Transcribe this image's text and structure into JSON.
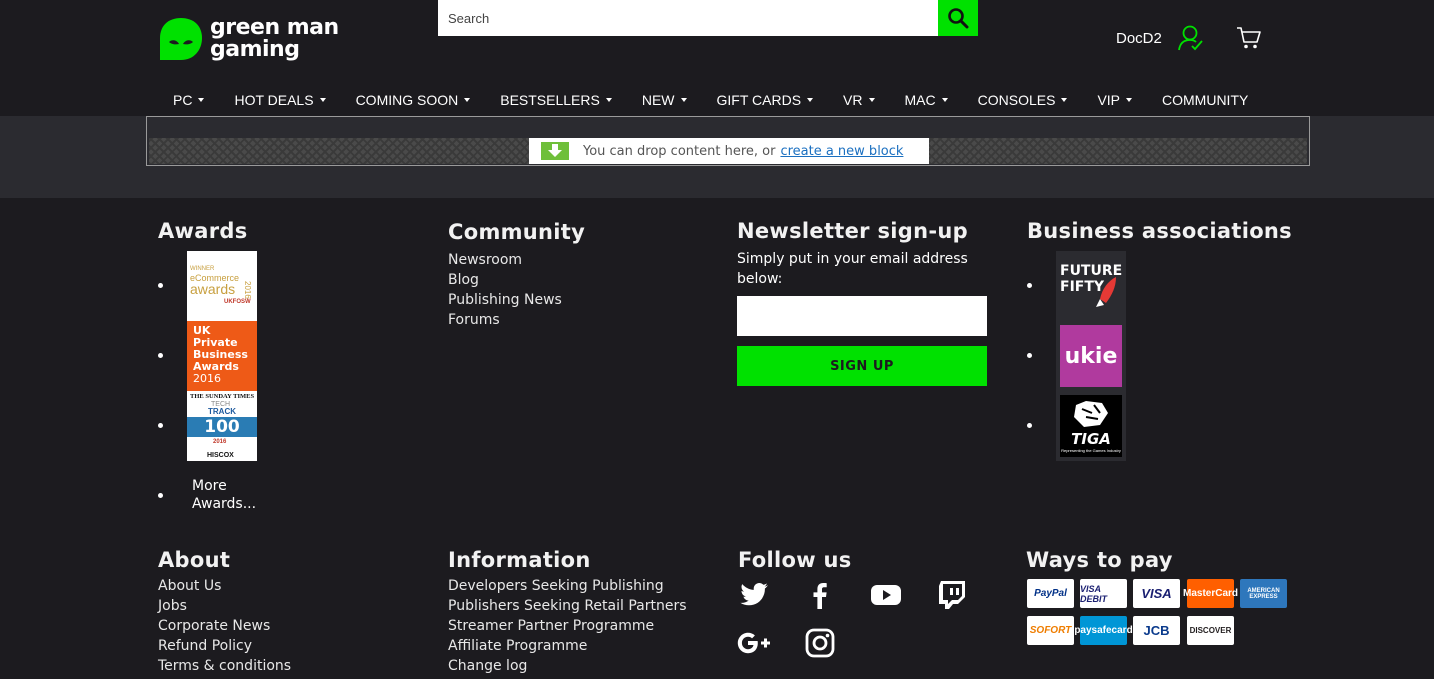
{
  "header": {
    "logo_line1": "green man",
    "logo_line2": "gaming",
    "search_placeholder": "Search",
    "username": "DocD2"
  },
  "nav": {
    "items": [
      {
        "label": "PC",
        "dropdown": true
      },
      {
        "label": "HOT DEALS",
        "dropdown": true
      },
      {
        "label": "COMING SOON",
        "dropdown": true
      },
      {
        "label": "BESTSELLERS",
        "dropdown": true
      },
      {
        "label": "NEW",
        "dropdown": true
      },
      {
        "label": "GIFT CARDS",
        "dropdown": true
      },
      {
        "label": "VR",
        "dropdown": true
      },
      {
        "label": "MAC",
        "dropdown": true
      },
      {
        "label": "CONSOLES",
        "dropdown": true
      },
      {
        "label": "VIP",
        "dropdown": true
      },
      {
        "label": "COMMUNITY",
        "dropdown": false
      }
    ]
  },
  "dropzone": {
    "message": "You can drop content here, or",
    "link": "create a new block"
  },
  "awards": {
    "title": "Awards",
    "badge1": {
      "line1": "WINNER",
      "line2": "eCommerce",
      "line3": "awards",
      "year": "2016",
      "sponsor": "UKFOSW"
    },
    "badge2": {
      "line1": "UK",
      "line2": "Private",
      "line3": "Business",
      "line4": "Awards",
      "year": "2016"
    },
    "badge3": {
      "line1": "THE SUNDAY TIMES",
      "line2": "TECH",
      "line3": "TRACK",
      "number": "100",
      "year": "2016",
      "sponsor": "HISCOX"
    },
    "more_line1": "More",
    "more_line2": "Awards..."
  },
  "community": {
    "title": "Community",
    "links": [
      "Newsroom",
      "Blog",
      "Publishing News",
      "Forums"
    ]
  },
  "newsletter": {
    "title": "Newsletter sign-up",
    "text": "Simply put in your email address below:",
    "button": "SIGN UP"
  },
  "business": {
    "title": "Business associations",
    "future_line1": "FUTURE",
    "future_line2": "FIFTY",
    "ukie": "ukie",
    "tiga": "TIGA",
    "tiga_caption": "Representing the Games Industry"
  },
  "about": {
    "title": "About",
    "links": [
      "About Us",
      "Jobs",
      "Corporate News",
      "Refund Policy",
      "Terms & conditions"
    ]
  },
  "information": {
    "title": "Information",
    "links": [
      "Developers Seeking Publishing",
      "Publishers Seeking Retail Partners",
      "Streamer Partner Programme",
      "Affiliate Programme",
      "Change log"
    ]
  },
  "follow": {
    "title": "Follow us",
    "icons": [
      "twitter-icon",
      "facebook-icon",
      "youtube-icon",
      "twitch-icon",
      "google-plus-icon",
      "instagram-icon"
    ]
  },
  "pay": {
    "title": "Ways to pay",
    "methods": [
      {
        "name": "PayPal",
        "color": "#003087"
      },
      {
        "name": "VISA DEBIT",
        "color": "#1a1f71"
      },
      {
        "name": "VISA",
        "color": "#1a1f71"
      },
      {
        "name": "MasterCard",
        "color": "#eb001b"
      },
      {
        "name": "AMERICAN EXPRESS",
        "color": "#2e77bc"
      },
      {
        "name": "SOFORT",
        "color": "#ef7d00"
      },
      {
        "name": "paysafecard",
        "color": "#0096d6"
      },
      {
        "name": "JCB",
        "color": "#0a3a8c"
      },
      {
        "name": "DISCOVER",
        "color": "#231f20"
      }
    ]
  },
  "colors": {
    "accent": "#00e100",
    "background": "#1c1b1f",
    "band": "#2b2b30"
  }
}
